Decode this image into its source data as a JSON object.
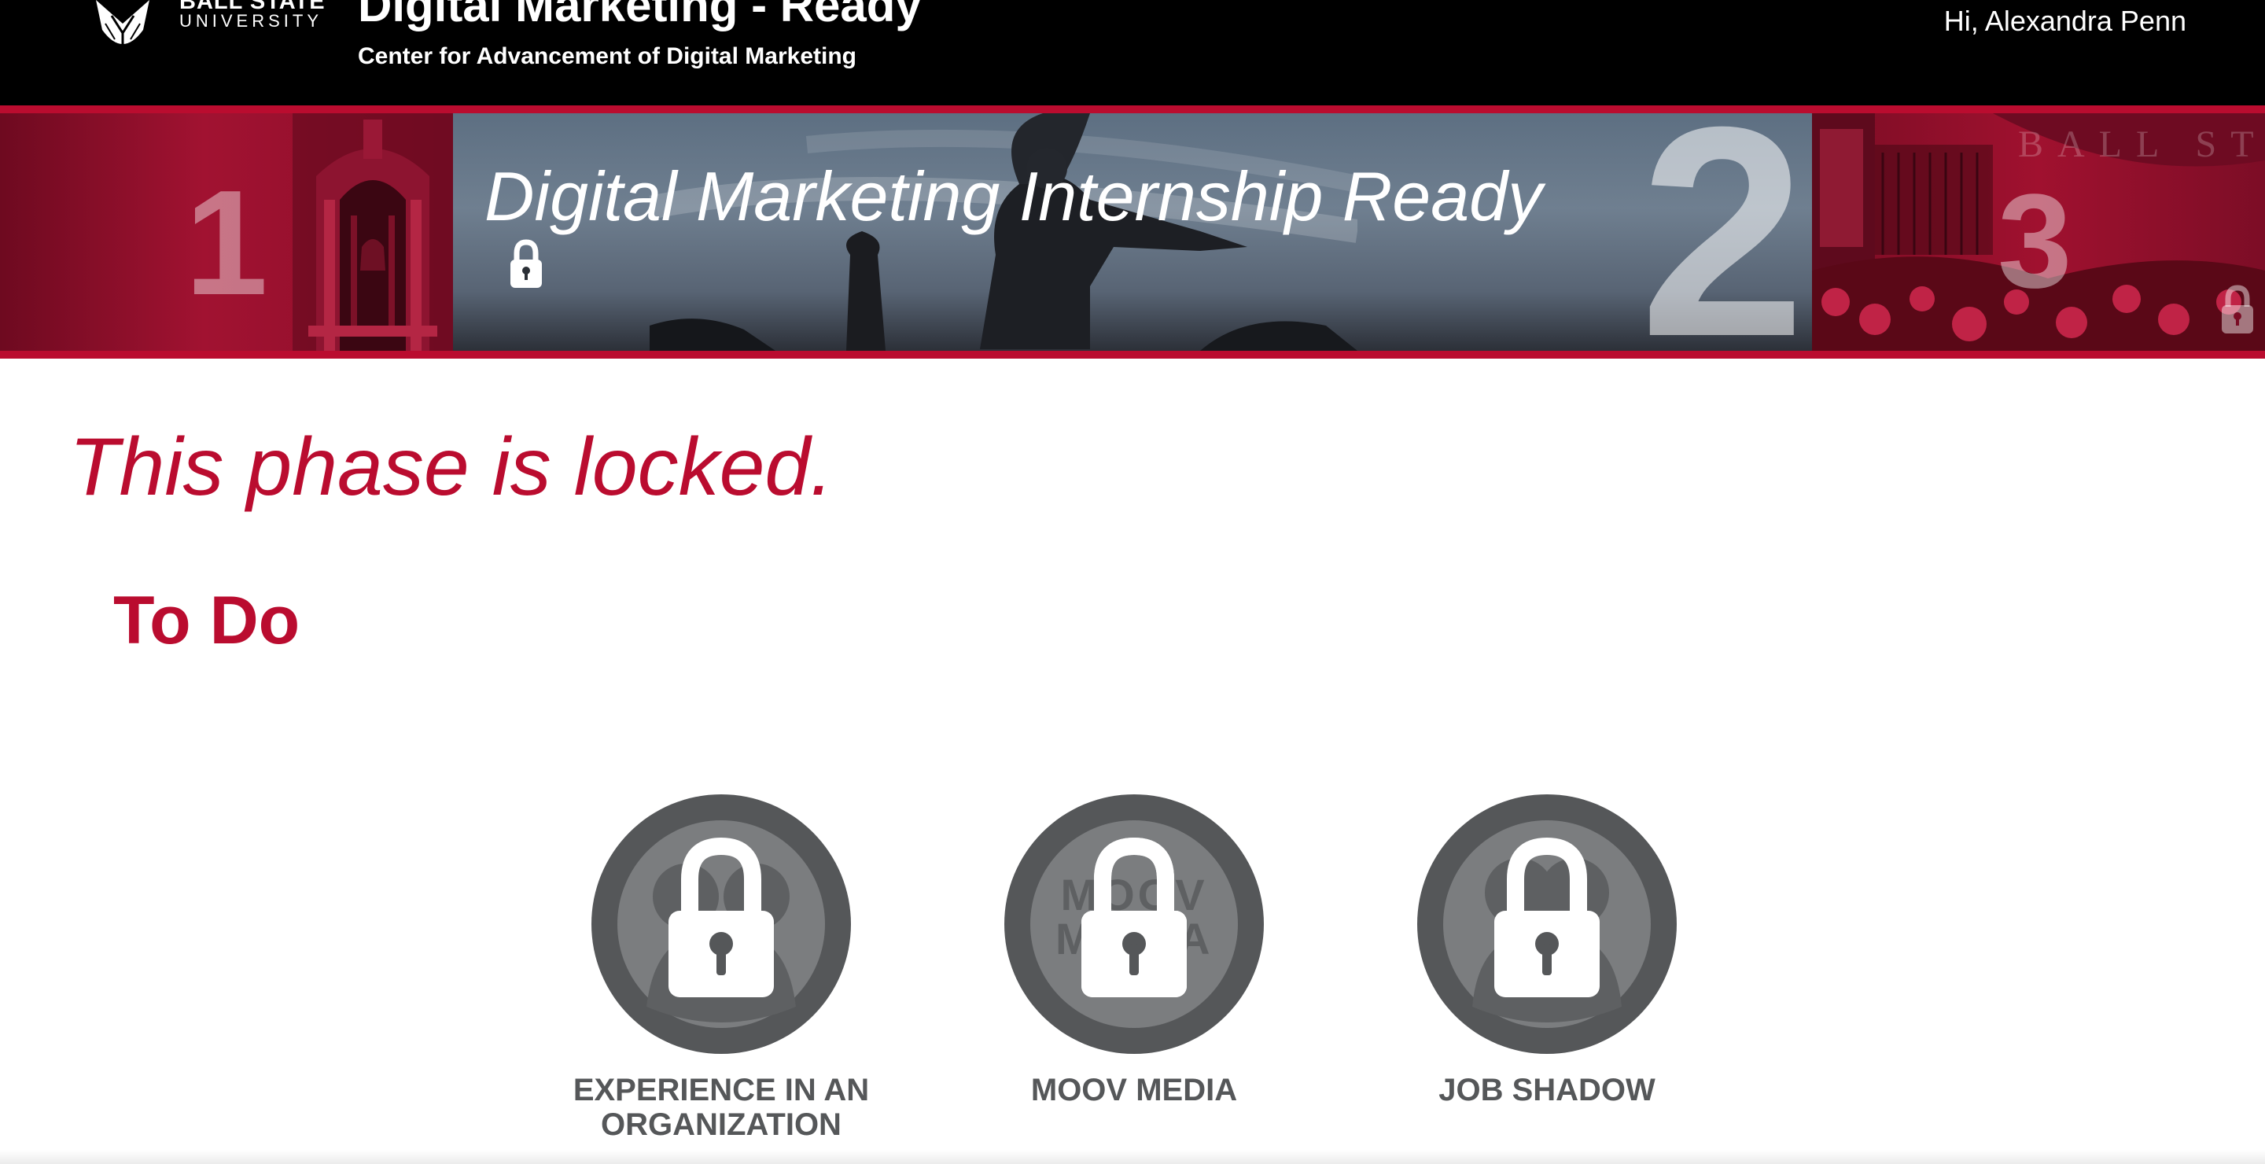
{
  "header": {
    "logo_line1": "BALL STATE",
    "logo_line2": "UNIVERSITY",
    "title": "Digital Marketing - Ready",
    "subtitle": "Center for Advancement of Digital Marketing",
    "greeting": "Hi, Alexandra Penn"
  },
  "phases": [
    {
      "number": "1",
      "state": "past"
    },
    {
      "number": "2",
      "title": "Digital Marketing Internship Ready",
      "state": "current-locked",
      "icon": "lock-icon"
    },
    {
      "number": "3",
      "state": "locked",
      "icon": "lock-icon",
      "image_text": "BALL STATE UNIVERSITY"
    }
  ],
  "main": {
    "locked_message": "This phase is locked.",
    "todo_heading": "To Do",
    "badges": [
      {
        "label": "EXPERIENCE IN AN ORGANIZATION",
        "icon": "lock-icon",
        "locked": true
      },
      {
        "label": "MOOV MEDIA",
        "icon": "lock-icon",
        "locked": true,
        "badge_text": "MOOV MEDIA"
      },
      {
        "label": "JOB SHADOW",
        "icon": "lock-icon",
        "locked": true
      }
    ]
  },
  "colors": {
    "brand_red": "#ba0c2f",
    "header_bg": "#000000",
    "badge_gray": "#555759",
    "badge_inner": "#7b7d7f"
  }
}
